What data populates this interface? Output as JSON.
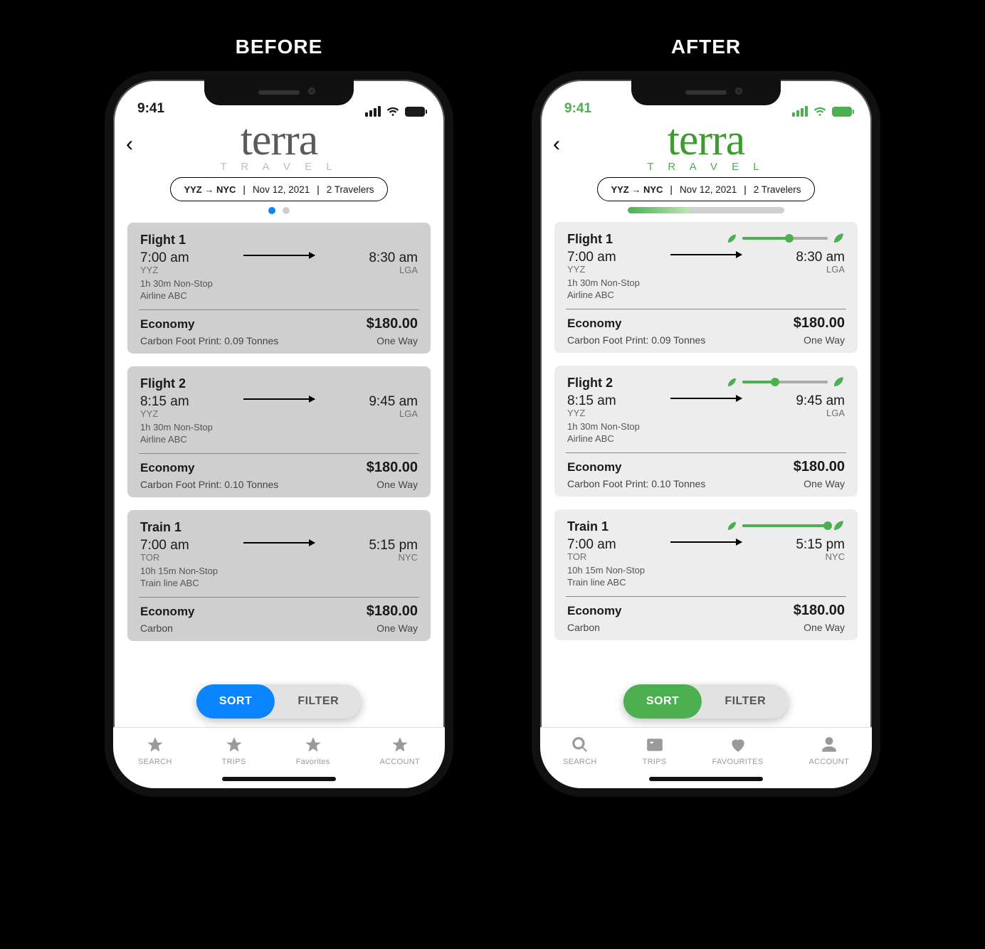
{
  "labels": {
    "before": "BEFORE",
    "after": "AFTER"
  },
  "status": {
    "time": "9:41"
  },
  "brand": {
    "name": "terra",
    "sub": "T R A V E L"
  },
  "route": {
    "from": "YYZ",
    "to": "NYC",
    "date": "Nov 12, 2021",
    "travelers": "2 Travelers"
  },
  "sf": {
    "sort": "SORT",
    "filter": "FILTER"
  },
  "before": {
    "tabs": [
      "SEARCH",
      "TRIPS",
      "Favorites",
      "ACCOUNT"
    ]
  },
  "after": {
    "tabs": [
      "SEARCH",
      "TRIPS",
      "FAVOURITES",
      "ACCOUNT"
    ],
    "progress_pct": 40
  },
  "results": [
    {
      "title": "Flight 1",
      "dep_time": "7:00 am",
      "dep_code": "YYZ",
      "arr_time": "8:30 am",
      "arr_code": "LGA",
      "duration": "1h 30m Non-Stop",
      "carrier": "Airline ABC",
      "class": "Economy",
      "price": "$180.00",
      "carbon": "Carbon Foot Print: 0.09 Tonnes",
      "way": "One Way",
      "eco_pct": 55
    },
    {
      "title": "Flight 2",
      "dep_time": "8:15 am",
      "dep_code": "YYZ",
      "arr_time": "9:45 am",
      "arr_code": "LGA",
      "duration": "1h 30m Non-Stop",
      "carrier": "Airline ABC",
      "class": "Economy",
      "price": "$180.00",
      "carbon": "Carbon Foot Print: 0.10 Tonnes",
      "way": "One Way",
      "eco_pct": 38
    },
    {
      "title": "Train 1",
      "dep_time": "7:00 am",
      "dep_code": "TOR",
      "arr_time": "5:15 pm",
      "arr_code": "NYC",
      "duration": "10h 15m Non-Stop",
      "carrier": "Train line ABC",
      "class": "Economy",
      "price": "$180.00",
      "carbon": "Carbon",
      "way": "One Way",
      "eco_pct": 100
    }
  ]
}
